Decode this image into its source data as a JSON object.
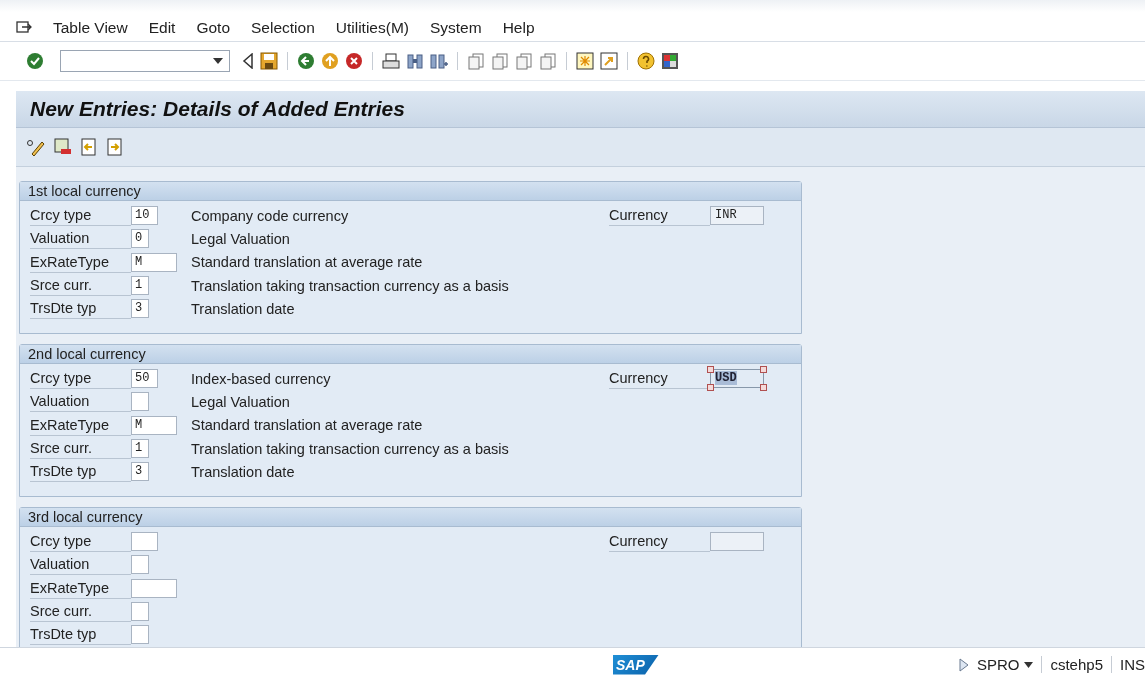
{
  "menu_bar": {
    "items": [
      "Table View",
      "Edit",
      "Goto",
      "Selection",
      "Utilities(M)",
      "System",
      "Help"
    ]
  },
  "title_bar": {
    "title": "New Entries: Details of Added Entries"
  },
  "groups": [
    {
      "title": "1st local currency",
      "currency_label": "Currency",
      "currency": {
        "value": "INR",
        "selected": false
      },
      "rows": [
        {
          "label": "Crcy type",
          "value": "10",
          "kind": "short",
          "description": "Company code currency"
        },
        {
          "label": "Valuation",
          "value": "0",
          "kind": "tiny",
          "description": "Legal Valuation"
        },
        {
          "label": "ExRateType",
          "value": "M",
          "kind": "long",
          "description": "Standard translation at average rate"
        },
        {
          "label": "Srce curr.",
          "value": "1",
          "kind": "tiny",
          "description": "Translation taking transaction currency as a basis"
        },
        {
          "label": "TrsDte typ",
          "value": "3",
          "kind": "tiny",
          "description": "Translation date"
        }
      ]
    },
    {
      "title": "2nd local currency",
      "currency_label": "Currency",
      "currency": {
        "value": "USD",
        "selected": true
      },
      "rows": [
        {
          "label": "Crcy type",
          "value": "50",
          "kind": "short",
          "description": "Index-based currency"
        },
        {
          "label": "Valuation",
          "kind": "tiny",
          "description": "Legal Valuation"
        },
        {
          "label": "ExRateType",
          "value": "M",
          "kind": "long",
          "description": "Standard translation at average rate"
        },
        {
          "label": "Srce curr.",
          "value": "1",
          "kind": "tiny",
          "description": "Translation taking transaction currency as a basis"
        },
        {
          "label": "TrsDte typ",
          "value": "3",
          "kind": "tiny",
          "description": "Translation date"
        }
      ]
    },
    {
      "title": "3rd local currency",
      "currency_label": "Currency",
      "currency": {
        "selected": false
      },
      "rows": [
        {
          "label": "Crcy type",
          "kind": "short"
        },
        {
          "label": "Valuation",
          "kind": "tiny"
        },
        {
          "label": "ExRateType",
          "kind": "long"
        },
        {
          "label": "Srce curr.",
          "kind": "tiny"
        },
        {
          "label": "TrsDte typ",
          "kind": "tiny"
        }
      ]
    }
  ],
  "status_bar": {
    "logo": "SAP",
    "transaction": "SPRO",
    "server": "cstehp5",
    "mode": "INS"
  }
}
